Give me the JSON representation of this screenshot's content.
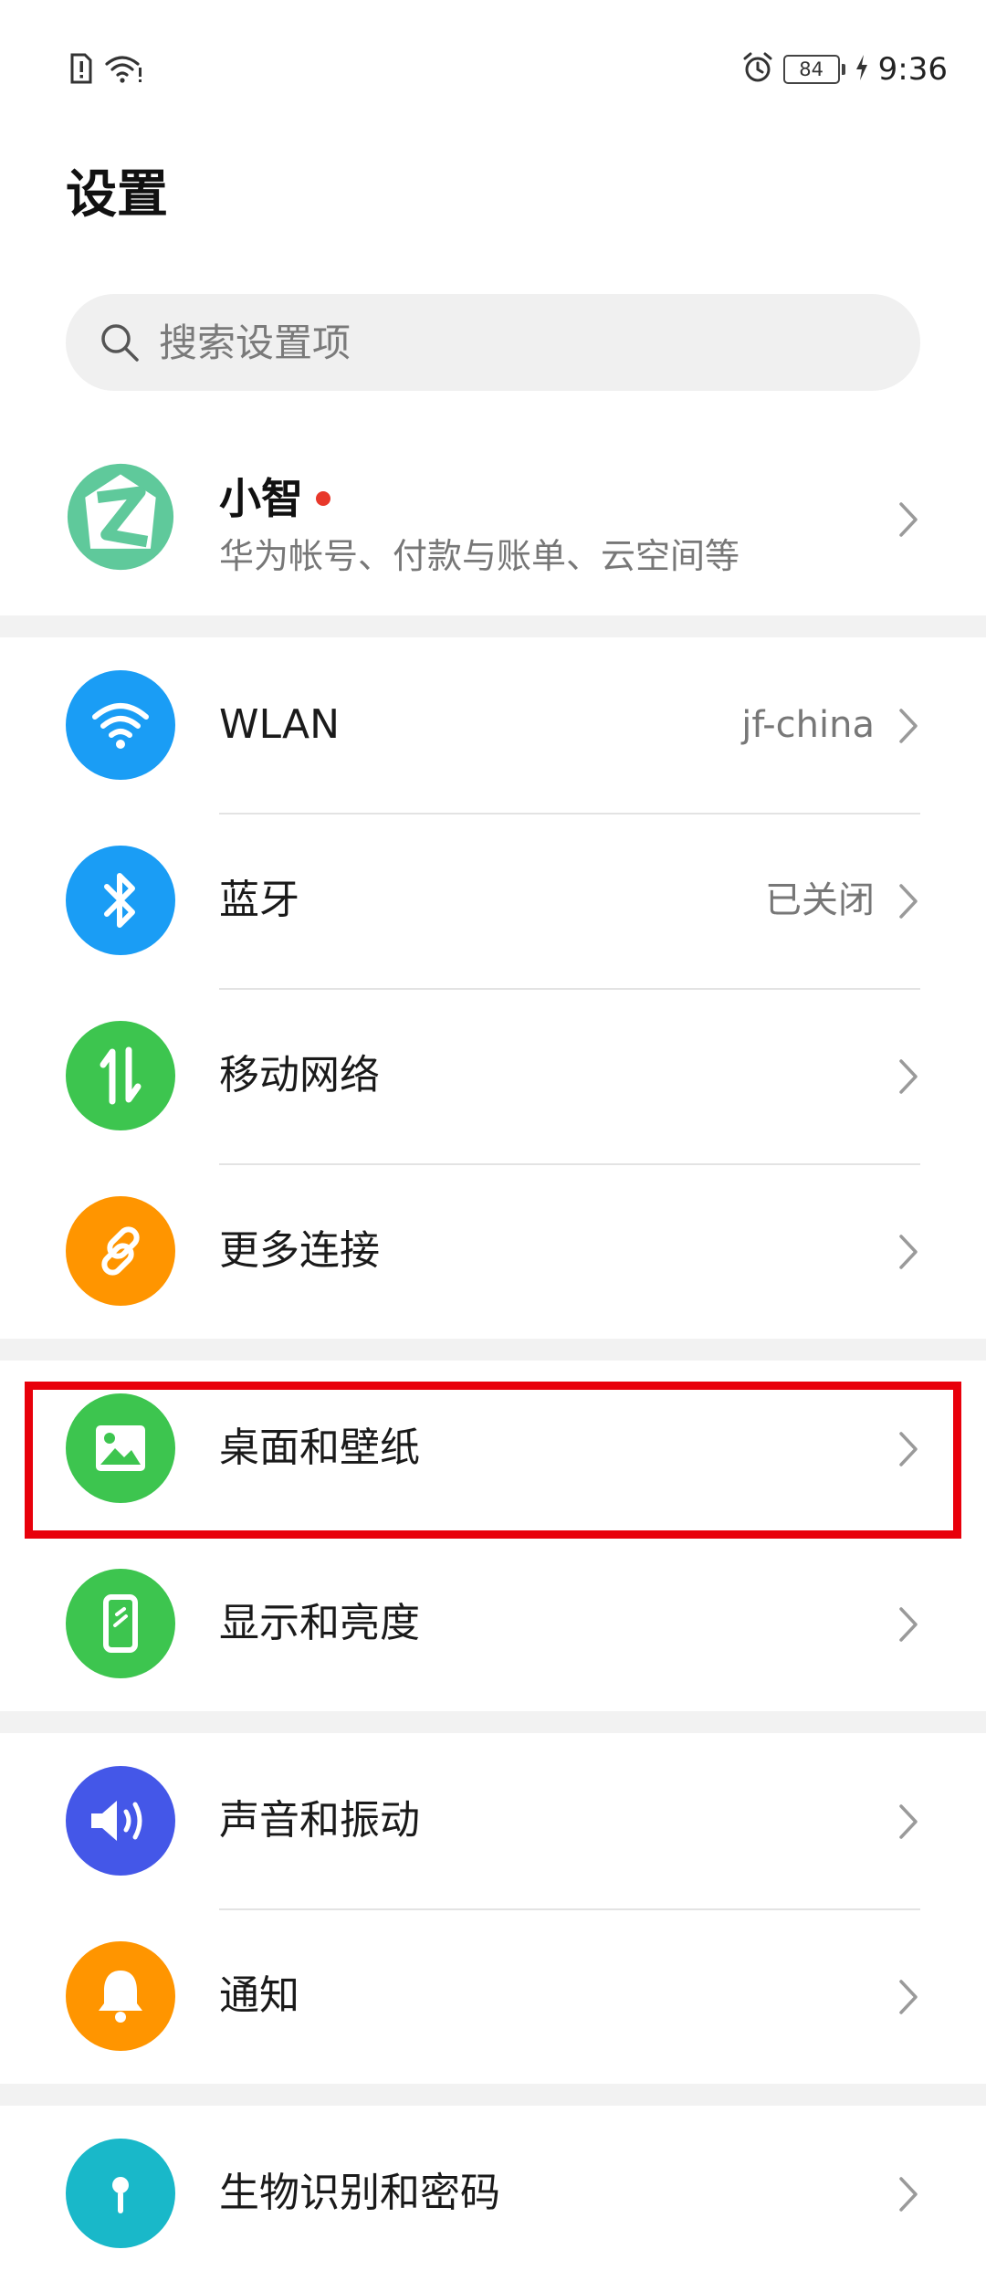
{
  "status_bar": {
    "time": "9:36",
    "battery": "84",
    "icons": [
      "sim-alert-icon",
      "wifi-icon",
      "alarm-icon",
      "battery-icon",
      "charging-icon"
    ]
  },
  "page": {
    "title": "设置"
  },
  "search": {
    "placeholder": "搜索设置项"
  },
  "account": {
    "name": "小智",
    "subtitle": "华为帐号、付款与账单、云空间等",
    "has_notification": true
  },
  "settings": [
    {
      "label": "WLAN",
      "value": "jf-china",
      "icon": "wifi-icon",
      "color": "#1a9df5"
    },
    {
      "label": "蓝牙",
      "value": "已关闭",
      "icon": "bluetooth-icon",
      "color": "#1a9df5"
    },
    {
      "label": "移动网络",
      "value": "",
      "icon": "mobile-data-icon",
      "color": "#3dc54f"
    },
    {
      "label": "更多连接",
      "value": "",
      "icon": "link-icon",
      "color": "#ff9500"
    },
    {
      "label": "桌面和壁纸",
      "value": "",
      "icon": "wallpaper-icon",
      "color": "#3dc54f",
      "highlighted": true
    },
    {
      "label": "显示和亮度",
      "value": "",
      "icon": "display-icon",
      "color": "#3dc54f"
    },
    {
      "label": "声音和振动",
      "value": "",
      "icon": "speaker-icon",
      "color": "#4457e8"
    },
    {
      "label": "通知",
      "value": "",
      "icon": "bell-icon",
      "color": "#ff9500"
    },
    {
      "label": "生物识别和密码",
      "value": "",
      "icon": "fingerprint-icon",
      "color": "#19b8c9"
    }
  ],
  "colors": {
    "highlight": "#e8000b",
    "accent_red": "#e8382a"
  }
}
